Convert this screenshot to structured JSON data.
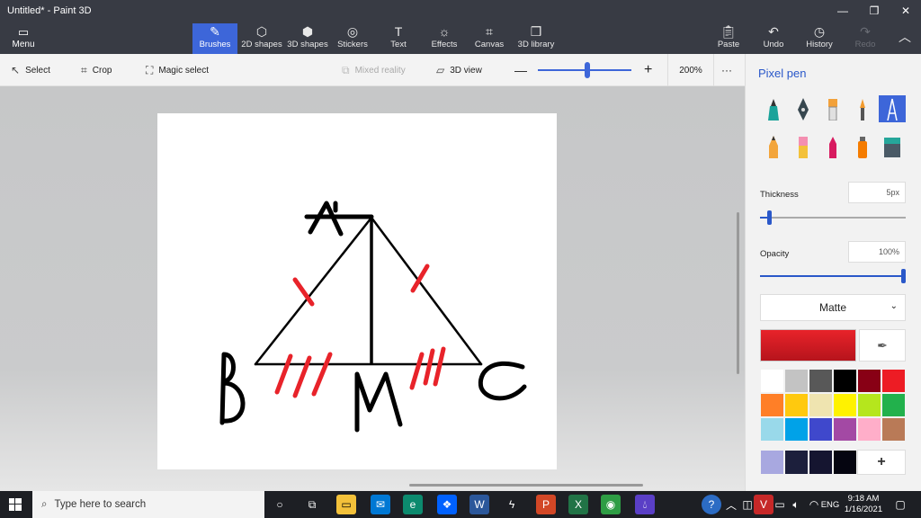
{
  "window": {
    "title": "Untitled* - Paint 3D",
    "controls": [
      "—",
      "❐",
      "✕"
    ]
  },
  "ribbon": {
    "menu_label": "Menu",
    "tools": [
      {
        "label": "Brushes",
        "icon": "brush-icon",
        "active": true
      },
      {
        "label": "2D shapes",
        "icon": "2d-shapes-icon"
      },
      {
        "label": "3D shapes",
        "icon": "3d-shapes-icon"
      },
      {
        "label": "Stickers",
        "icon": "stickers-icon"
      },
      {
        "label": "Text",
        "icon": "text-icon"
      },
      {
        "label": "Effects",
        "icon": "effects-icon"
      },
      {
        "label": "Canvas",
        "icon": "canvas-icon"
      },
      {
        "label": "3D library",
        "icon": "3d-library-icon"
      }
    ],
    "right_tools": [
      {
        "label": "Paste",
        "icon": "paste-icon"
      },
      {
        "label": "Undo",
        "icon": "undo-icon"
      },
      {
        "label": "History",
        "icon": "history-icon"
      },
      {
        "label": "Redo",
        "icon": "redo-icon",
        "disabled": true
      }
    ]
  },
  "toolbar": {
    "select": "Select",
    "crop": "Crop",
    "magic_select": "Magic select",
    "mixed_reality": "Mixed reality",
    "view_3d": "3D view",
    "zoom": "200%",
    "zoom_level": 0.5,
    "more": "···"
  },
  "drawing": {
    "labels": [
      "A",
      "B",
      "M",
      "C"
    ],
    "ink_color": "#000000",
    "mark_color": "#e8232a"
  },
  "panel": {
    "title": "Pixel pen",
    "brushes": [
      "marker-icon",
      "calligraphy-pen-icon",
      "oil-brush-icon",
      "watercolor-icon",
      "pixel-pen-icon",
      "pencil-icon",
      "eraser-icon",
      "crayon-icon",
      "spray-can-icon",
      "fill-bucket-icon"
    ],
    "thickness_label": "Thickness",
    "thickness_value": "5px",
    "thickness_level": 0.05,
    "opacity_label": "Opacity",
    "opacity_value": "100%",
    "opacity_level": 1.0,
    "finish": "Matte",
    "current_color": "#e8232a",
    "palette": [
      "#ffffff",
      "#c3c3c3",
      "#585858",
      "#000000",
      "#880015",
      "#ed1c24",
      "#ff7f27",
      "#ffc90e",
      "#efe4b0",
      "#fff200",
      "#b5e61d",
      "#22b14c",
      "#99d9ea",
      "#00a2e8",
      "#3f48cc",
      "#a349a4",
      "#ffaec9",
      "#b97a57"
    ],
    "custom_colors": [
      "#a8a8e0",
      "#1c1f3c",
      "#151530",
      "#050510"
    ]
  },
  "taskbar": {
    "search_placeholder": "Type here to search",
    "time": "9:18 AM",
    "date": "1/16/2021",
    "lang": "ENG"
  }
}
